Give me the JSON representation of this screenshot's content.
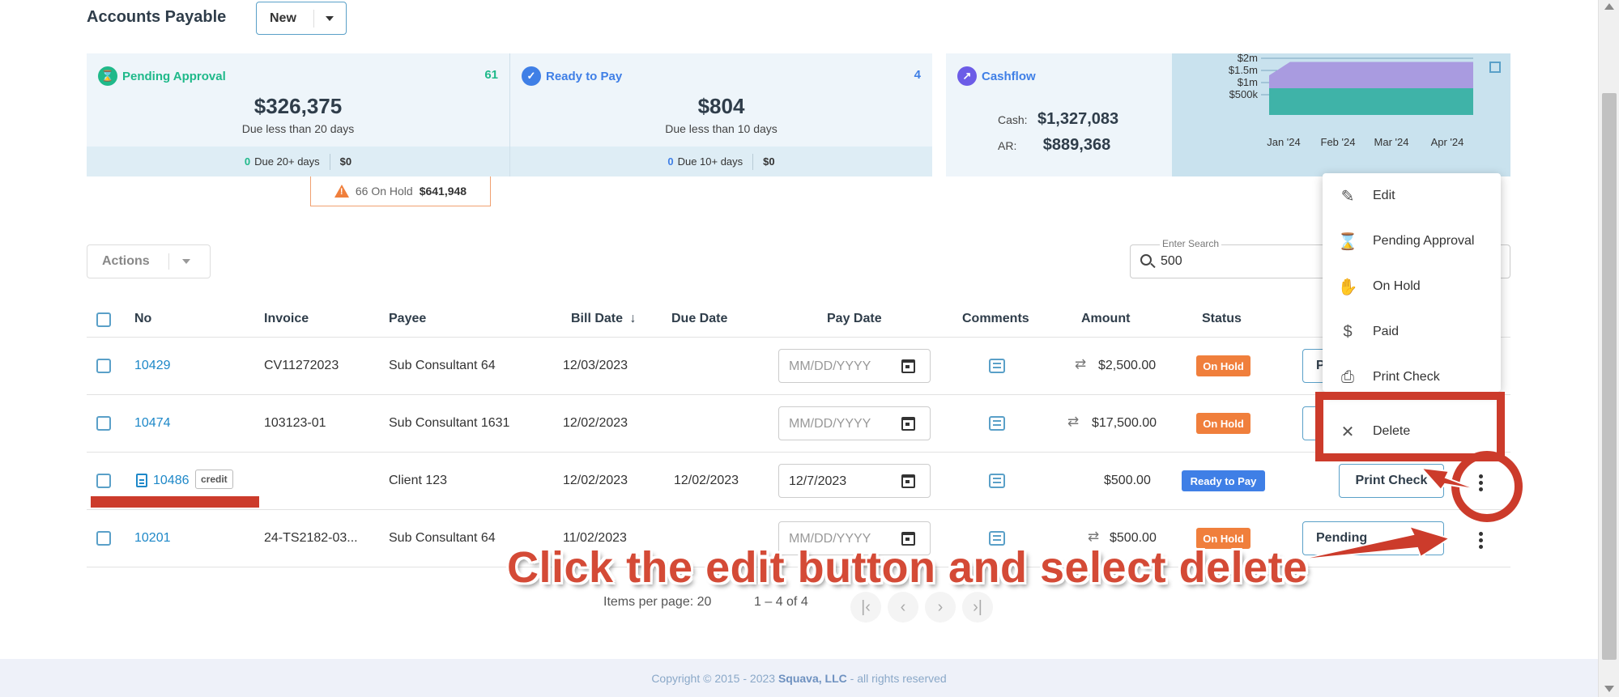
{
  "header": {
    "title": "Accounts Payable",
    "new_label": "New"
  },
  "cards": {
    "pending": {
      "label": "Pending Approval",
      "count": "61",
      "amount": "$326,375",
      "sub": "Due less than 20 days",
      "foot_num": "0",
      "foot_text": "Due 20+ days",
      "foot_amt": "$0",
      "color": "#1fb98a"
    },
    "ready": {
      "label": "Ready to Pay",
      "count": "4",
      "amount": "$804",
      "sub": "Due less than 10 days",
      "foot_num": "0",
      "foot_text": "Due 10+ days",
      "foot_amt": "$0",
      "color": "#3f7fe6"
    },
    "cashflow": {
      "label": "Cashflow",
      "cash_label": "Cash:",
      "cash_value": "$1,327,083",
      "ar_label": "AR:",
      "ar_value": "$889,368",
      "color": "#6c5ce7"
    },
    "on_hold": {
      "count_text": "66 On Hold",
      "amount": "$641,948"
    }
  },
  "chart_data": {
    "type": "area",
    "categories": [
      "Jan '24",
      "Feb '24",
      "Mar '24",
      "Apr '24"
    ],
    "ytick_labels": [
      "$2m",
      "$1.5m",
      "$1m",
      "$500k"
    ],
    "ylim": [
      0,
      2000000
    ],
    "series": [
      {
        "values": [
          1850000,
          1850000,
          1850000,
          1850000
        ],
        "color": "#a99be0"
      },
      {
        "values": [
          500000,
          500000,
          500000,
          500000
        ],
        "color": "#3fb3a8"
      }
    ]
  },
  "toolbar": {
    "actions_label": "Actions",
    "search_legend": "Enter Search",
    "search_value": "500"
  },
  "table": {
    "headers": [
      "No",
      "Invoice",
      "Payee",
      "Bill Date",
      "Due Date",
      "Pay Date",
      "Comments",
      "Amount",
      "Status"
    ],
    "rows": [
      {
        "no": "10429",
        "invoice": "CV11272023",
        "payee": "Sub Consultant 64",
        "bill_date": "12/03/2023",
        "due_date": "",
        "pay_date": "MM/DD/YYYY",
        "amount": "$2,500.00",
        "status": "On Hold",
        "action": "P"
      },
      {
        "no": "10474",
        "invoice": "103123-01",
        "payee": "Sub Consultant 1631",
        "bill_date": "12/02/2023",
        "due_date": "",
        "pay_date": "MM/DD/YYYY",
        "amount": "$17,500.00",
        "status": "On Hold",
        "action": ""
      },
      {
        "no": "10486",
        "tag": "credit",
        "invoice": "",
        "payee": "Client 123",
        "bill_date": "12/02/2023",
        "due_date": "12/02/2023",
        "pay_date": "12/7/2023",
        "amount": "$500.00",
        "status": "Ready to Pay",
        "action": "Print Check"
      },
      {
        "no": "10201",
        "invoice": "24-TS2182-03...",
        "payee": "Sub Consultant 64",
        "bill_date": "11/02/2023",
        "due_date": "",
        "pay_date": "MM/DD/YYYY",
        "amount": "$500.00",
        "status": "On Hold",
        "action": "Pending"
      }
    ]
  },
  "pagination": {
    "per_page": "Items per page: 20",
    "range": "1 – 4 of 4"
  },
  "menu": {
    "items": [
      "Edit",
      "Pending Approval",
      "On Hold",
      "Paid",
      "Print Check",
      "Delete"
    ]
  },
  "footer": {
    "prefix": "Copyright © 2015 - 2023",
    "company": "Squava, LLC",
    "suffix": "- all rights reserved"
  },
  "annotation": {
    "text": "Click the edit button and select delete",
    "color": "#cc3b2b"
  }
}
